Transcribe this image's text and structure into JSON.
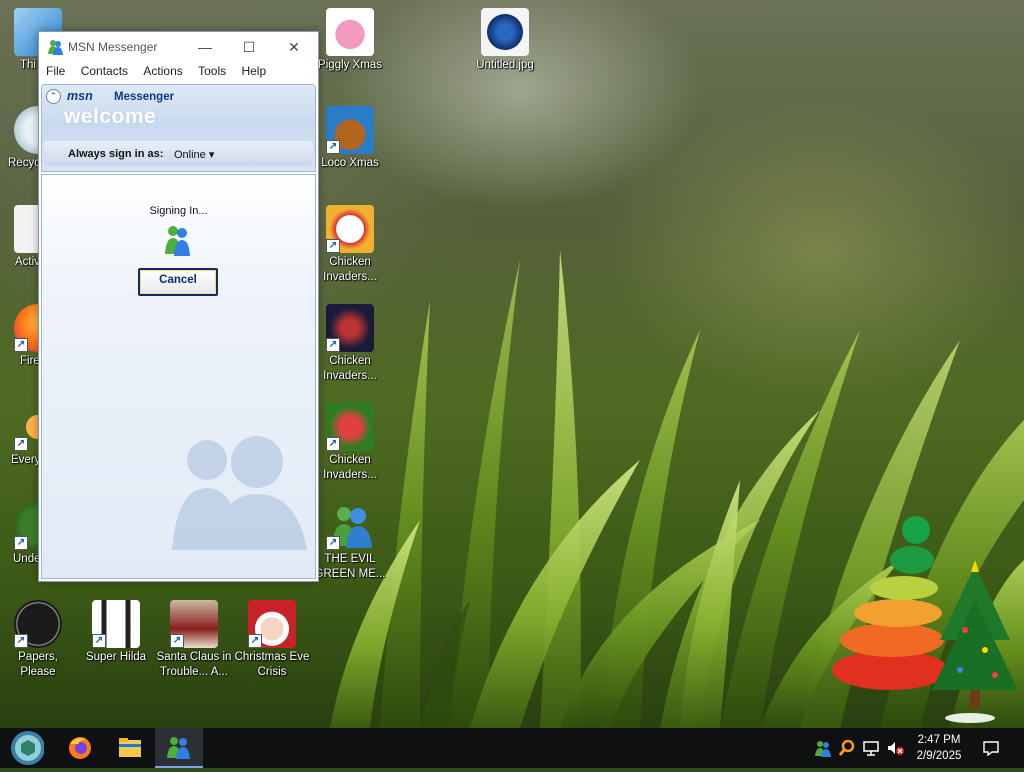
{
  "desktop": {
    "icons": [
      {
        "label": "Thi",
        "name": "this-pc"
      },
      {
        "label": "Recyc",
        "name": "recycle-bin"
      },
      {
        "label": "Activ",
        "name": "activ"
      },
      {
        "label": "Fire",
        "name": "firefox-shortcut"
      },
      {
        "label": "Every",
        "name": "every"
      },
      {
        "label": "Unde",
        "name": "unde"
      },
      {
        "label": "Papers, Please",
        "name": "papers-please"
      },
      {
        "label": "Super Hilda",
        "name": "super-hilda"
      },
      {
        "label": "Santa Claus in Trouble... A...",
        "name": "santa-claus-in-trouble"
      },
      {
        "label": "Christmas Eve Crisis",
        "name": "christmas-eve-crisis"
      },
      {
        "label": "Piggly Xmas",
        "name": "piggly-xmas"
      },
      {
        "label": "Loco Xmas",
        "name": "loco-xmas"
      },
      {
        "label": "Chicken Invaders...",
        "name": "chicken-invaders-1"
      },
      {
        "label": "Chicken Invaders...",
        "name": "chicken-invaders-2"
      },
      {
        "label": "Chicken Invaders...",
        "name": "chicken-invaders-3"
      },
      {
        "label": "THE EVIL GREEN ME...",
        "name": "the-evil-green-me"
      },
      {
        "label": "Untitled.jpg",
        "name": "untitled-jpg"
      }
    ]
  },
  "window": {
    "title": "MSN Messenger",
    "controls": {
      "minimize": "—",
      "maximize": "☐",
      "close": "✕"
    },
    "menu": [
      "File",
      "Contacts",
      "Actions",
      "Tools",
      "Help"
    ],
    "header": {
      "brand": "msn",
      "brand_label": "Messenger",
      "welcome": "welcome",
      "signin_label": "Always sign in as:",
      "status": "Online ▾"
    },
    "body": {
      "status_text": "Signing In...",
      "cancel_label": "Cancel"
    }
  },
  "taskbar": {
    "time": "2:47 PM",
    "date": "2/9/2025"
  }
}
